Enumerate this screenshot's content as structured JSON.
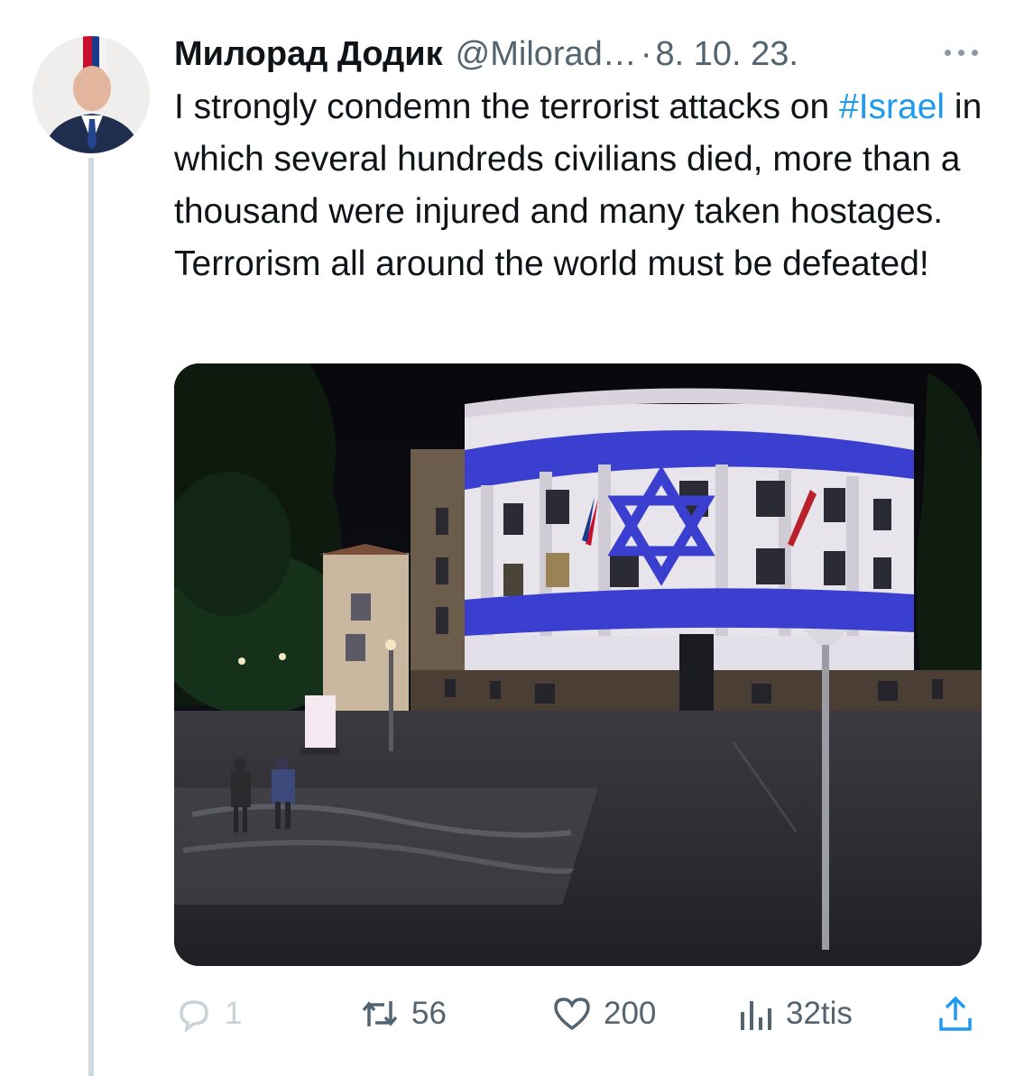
{
  "tweet": {
    "author_name": "Милорад Додик",
    "author_handle": "@Milorad…",
    "date_separator": "·",
    "date": "8. 10. 23.",
    "text_parts": [
      "I strongly condemn the terrorist attacks on",
      "#Israel",
      " in which several hundreds civilians died, more than a thousand were injured and many taken hostages. Terrorism all around the world must  be defeated!"
    ]
  },
  "actions": {
    "replies": "1",
    "retweets": "56",
    "likes": "200",
    "views": "32tis"
  },
  "icons": {
    "avatar": "avatar-photo",
    "more": "more-dots-icon",
    "reply": "reply-bubble-icon",
    "retweet": "retweet-arrows-icon",
    "like": "heart-icon",
    "views": "bar-chart-icon",
    "share": "share-upload-icon"
  },
  "colors": {
    "text": "#0f1419",
    "secondary": "#536471",
    "link": "#1d9bf0",
    "thread_line": "#cfd9de",
    "flag_blue": "#3a3fd0"
  }
}
